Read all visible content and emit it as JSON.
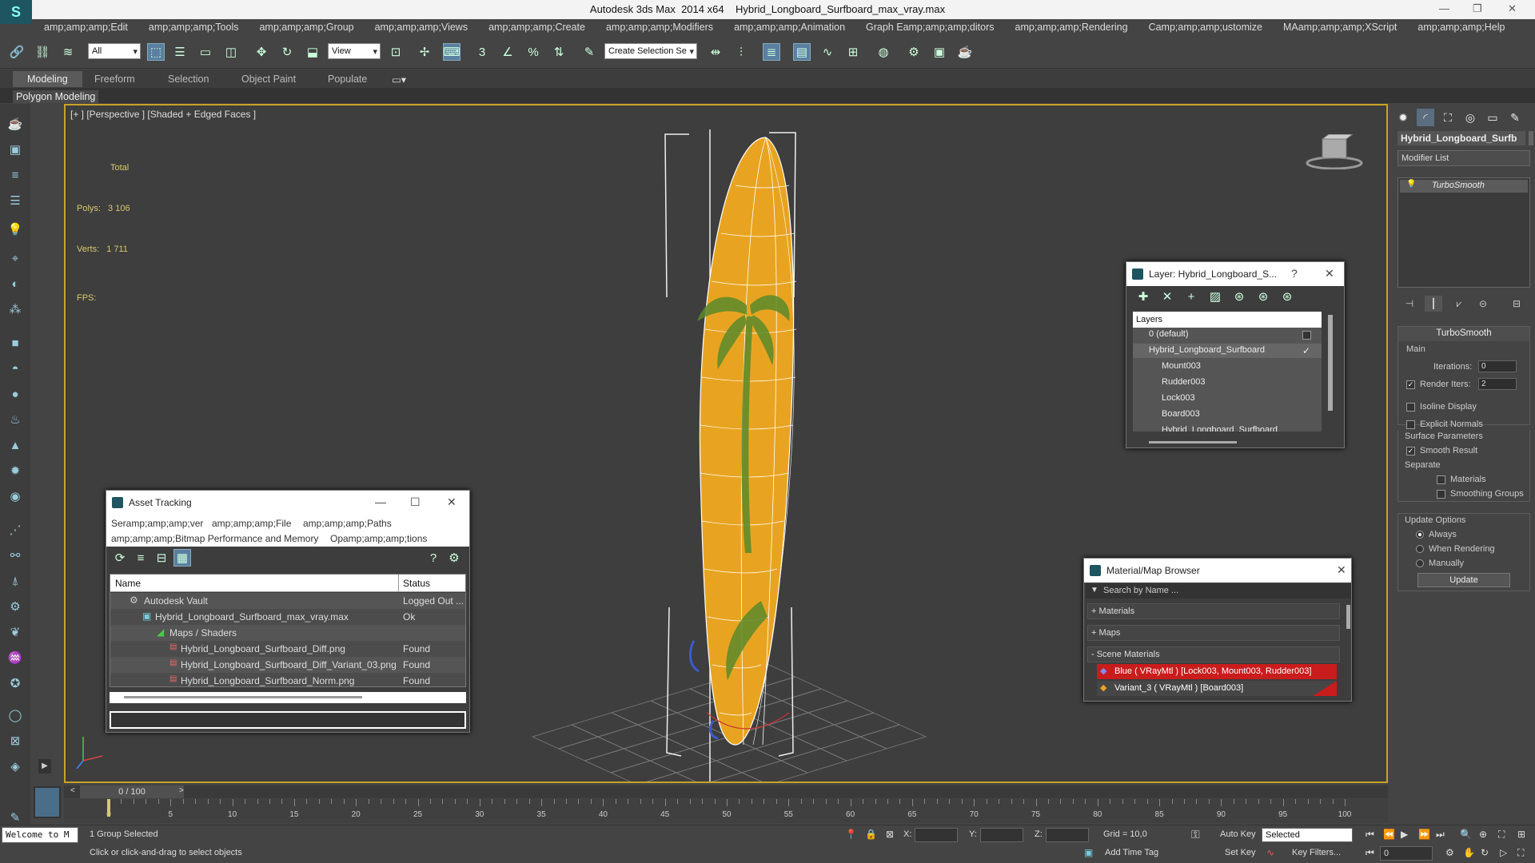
{
  "window": {
    "title": "Autodesk 3ds Max  2014 x64    Hybrid_Longboard_Surfboard_max_vray.max"
  },
  "menu": [
    "amp;amp;amp;Edit",
    "amp;amp;amp;Tools",
    "amp;amp;amp;Group",
    "amp;amp;amp;Views",
    "amp;amp;amp;Create",
    "amp;amp;amp;Modifiers",
    "amp;amp;amp;Animation",
    "Graph Eamp;amp;amp;ditors",
    "amp;amp;amp;Rendering",
    "Camp;amp;amp;ustomize",
    "MAamp;amp;amp;XScript",
    "amp;amp;amp;Help"
  ],
  "toolbar": {
    "filter_select": "All",
    "coord_select": "View",
    "selection_set": "Create Selection Se"
  },
  "ribbon": {
    "tabs": [
      "Modeling",
      "Freeform",
      "Selection",
      "Object Paint",
      "Populate"
    ],
    "sub": "Polygon Modeling"
  },
  "viewport": {
    "label": "[+ ] [Perspective ] [Shaded + Edged Faces ]",
    "total": "Total",
    "polys_label": "Polys:",
    "polys": "3 106",
    "verts_label": "Verts:",
    "verts": "1 711",
    "fps": "FPS:"
  },
  "command_panel": {
    "object_name": "Hybrid_Longboard_Surfb",
    "modifier_list": "Modifier List",
    "stack_item": "TurboSmooth",
    "turbosmooth": {
      "title": "TurboSmooth",
      "main": "Main",
      "iterations_label": "Iterations:",
      "iterations": "0",
      "render_iters_label": "Render Iters:",
      "render_iters": "2",
      "isoline": "Isoline Display",
      "explicit": "Explicit Normals",
      "surface": "Surface Parameters",
      "smooth_result": "Smooth Result",
      "separate": "Separate",
      "materials": "Materials",
      "smoothing": "Smoothing Groups",
      "update_options": "Update Options",
      "always": "Always",
      "when_rendering": "When Rendering",
      "manually": "Manually",
      "update": "Update"
    }
  },
  "layer_dialog": {
    "title": "Layer: Hybrid_Longboard_S...",
    "help": "?",
    "header": "Layers",
    "items": [
      "0 (default)",
      "Hybrid_Longboard_Surfboard",
      "Mount003",
      "Rudder003",
      "Lock003",
      "Board003",
      "Hybrid_Longboard_Surfboard"
    ]
  },
  "asset_tracking": {
    "title": "Asset Tracking",
    "menu1": [
      "Seramp;amp;amp;ver",
      "amp;amp;amp;File",
      "amp;amp;amp;Paths"
    ],
    "menu2": [
      "amp;amp;amp;Bitmap Performance and Memory",
      "Opamp;amp;amp;tions"
    ],
    "col_name": "Name",
    "col_status": "Status",
    "rows": [
      {
        "name": "Autodesk Vault",
        "status": "Logged Out ..."
      },
      {
        "name": "Hybrid_Longboard_Surfboard_max_vray.max",
        "status": "Ok"
      },
      {
        "name": "Maps / Shaders",
        "status": ""
      },
      {
        "name": "Hybrid_Longboard_Surfboard_Diff.png",
        "status": "Found"
      },
      {
        "name": "Hybrid_Longboard_Surfboard_Diff_Variant_03.png",
        "status": "Found"
      },
      {
        "name": "Hybrid_Longboard_Surfboard_Norm.png",
        "status": "Found"
      }
    ]
  },
  "material_browser": {
    "title": "Material/Map Browser",
    "search": "Search by Name ...",
    "materials": "+ Materials",
    "maps": "+ Maps",
    "scene": "- Scene Materials",
    "items": [
      "Blue  ( VRayMtl )  [Lock003, Mount003, Rudder003]",
      "Variant_3  ( VRayMtl )  [Board003]"
    ]
  },
  "timeline": {
    "frame": "0 / 100",
    "ticks": [
      "0",
      "5",
      "10",
      "15",
      "20",
      "25",
      "30",
      "35",
      "40",
      "45",
      "50",
      "55",
      "60",
      "65",
      "70",
      "75",
      "80",
      "85",
      "90",
      "95",
      "100"
    ]
  },
  "status": {
    "welcome": "Welcome to M",
    "selected": "1 Group Selected",
    "prompt": "Click or click-and-drag to select objects",
    "x": "X:",
    "y": "Y:",
    "z": "Z:",
    "grid": "Grid = 10,0",
    "add_time_tag": "Add Time Tag",
    "auto_key": "Auto Key",
    "selected_select": "Selected",
    "set_key": "Set Key",
    "key_filters": "Key Filters...",
    "frame_field": "0"
  }
}
